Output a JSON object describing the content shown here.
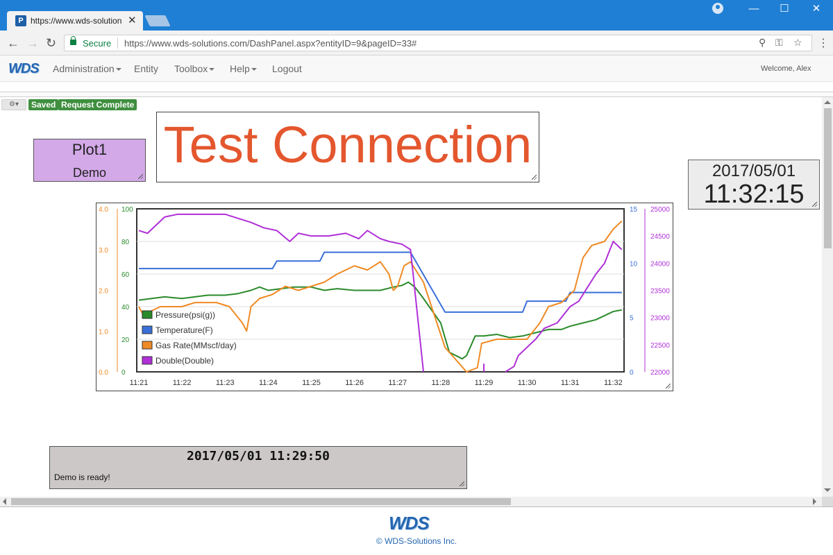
{
  "browser": {
    "tab_title": "https://www.wds-solution",
    "tab_favicon": "P",
    "secure_label": "Secure",
    "url": "https://www.wds-solutions.com/DashPanel.aspx?entityID=9&pageID=33#"
  },
  "navbar": {
    "brand": "WDS",
    "items": [
      {
        "label": "Administration",
        "dropdown": true
      },
      {
        "label": "Entity",
        "dropdown": false
      },
      {
        "label": "Toolbox",
        "dropdown": true
      },
      {
        "label": "Help",
        "dropdown": true
      },
      {
        "label": "Logout",
        "dropdown": false
      }
    ],
    "welcome": "Welcome, Alex"
  },
  "toolbar": {
    "gear_icon": "gear-icon",
    "badges": [
      "Saved",
      "Request Complete"
    ],
    "badge_color": "#3f8f3f"
  },
  "widgets": {
    "plot1": {
      "title": "Plot1",
      "subtitle": "Demo",
      "bg": "#d3a9e8"
    },
    "test_connection": {
      "text": "Test Connection",
      "color": "#e4572e"
    },
    "clock": {
      "date": "2017/05/01",
      "time": "11:32:15"
    },
    "status": {
      "timestamp": "2017/05/01 11:29:50",
      "message": "Demo is ready!"
    }
  },
  "footer": {
    "logo": "WDS",
    "copyright": "© WDS-Solutions Inc."
  },
  "chart_data": {
    "type": "line",
    "x_ticks": [
      "11:21",
      "11:22",
      "11:23",
      "11:24",
      "11:25",
      "11:26",
      "11:27",
      "11:28",
      "11:29",
      "11:30",
      "11:31",
      "11:32"
    ],
    "axes": [
      {
        "id": "gas",
        "side": "left-outer",
        "color": "#f08a24",
        "ticks": [
          "0.0",
          "1.0",
          "2.0",
          "3.0",
          "4.0"
        ],
        "range": [
          0,
          4
        ]
      },
      {
        "id": "pressure",
        "side": "left-inner",
        "color": "#2a8a2a",
        "ticks": [
          "0",
          "20",
          "40",
          "60",
          "80",
          "100"
        ],
        "range": [
          0,
          100
        ]
      },
      {
        "id": "temp",
        "side": "right-inner",
        "color": "#3a6fd8",
        "ticks": [
          "0",
          "5",
          "10",
          "15"
        ],
        "range": [
          0,
          15
        ]
      },
      {
        "id": "double",
        "side": "right-outer",
        "color": "#b02fd8",
        "ticks": [
          "22000",
          "22500",
          "23000",
          "23500",
          "24000",
          "24500",
          "25000"
        ],
        "range": [
          22000,
          25000
        ]
      }
    ],
    "legend_position": "bottom-left",
    "grid": true,
    "series": [
      {
        "name": "Pressure(psi(g))",
        "axis": "pressure",
        "color": "#2a8a2a",
        "x": [
          0,
          0.3,
          0.6,
          1.0,
          1.3,
          1.6,
          2.0,
          2.3,
          2.6,
          2.8,
          3.0,
          3.3,
          3.6,
          4.0,
          4.3,
          4.6,
          5.0,
          5.3,
          5.6,
          5.9,
          6.1,
          6.25,
          6.4,
          6.6,
          7.0,
          7.2,
          7.5,
          7.6,
          7.8,
          8.0,
          8.3,
          8.6,
          8.9,
          9.2,
          9.5,
          9.8,
          10.0,
          10.3,
          10.6,
          11.0,
          11.2
        ],
        "y": [
          44,
          45,
          46,
          45,
          46,
          47,
          47,
          48,
          50,
          52,
          50,
          51,
          52,
          52,
          50,
          51,
          50,
          50,
          50,
          52,
          53,
          55,
          52,
          45,
          30,
          12,
          8,
          10,
          22,
          22,
          23,
          21,
          22,
          24,
          26,
          26,
          28,
          30,
          32,
          37,
          38
        ]
      },
      {
        "name": "Temperature(F)",
        "axis": "temp",
        "color": "#3a6fd8",
        "x": [
          0,
          3.1,
          3.2,
          4.2,
          4.3,
          6.3,
          7.1,
          8.9,
          9.0,
          9.9,
          10.0,
          11.2
        ],
        "y": [
          9.5,
          9.5,
          10.2,
          10.2,
          11,
          11,
          5.5,
          5.5,
          6.5,
          6.5,
          7.3,
          7.3
        ]
      },
      {
        "name": "Gas Rate(MMscf/day)",
        "axis": "gas",
        "color": "#f08a24",
        "x": [
          0,
          0.1,
          0.5,
          1.0,
          1.3,
          1.8,
          2.1,
          2.4,
          2.5,
          2.6,
          2.8,
          3.1,
          3.4,
          3.7,
          4.0,
          4.3,
          4.6,
          5.0,
          5.3,
          5.6,
          5.8,
          5.9,
          6.0,
          6.15,
          6.3,
          6.6,
          7.1,
          7.6,
          7.85,
          7.95,
          8.3,
          8.7,
          9.0,
          9.3,
          9.5,
          9.8,
          10.1,
          10.3,
          10.5,
          10.8,
          11.0,
          11.2
        ],
        "y": [
          1.6,
          1.4,
          1.6,
          1.6,
          1.7,
          1.7,
          1.6,
          1.2,
          1.0,
          1.6,
          1.8,
          1.9,
          2.1,
          2.0,
          2.1,
          2.2,
          2.4,
          2.6,
          2.5,
          2.7,
          2.4,
          2.0,
          2.1,
          2.6,
          2.7,
          2.2,
          0.6,
          0.0,
          0.1,
          0.7,
          0.8,
          0.8,
          0.8,
          1.2,
          1.6,
          1.7,
          2.0,
          2.8,
          3.1,
          3.2,
          3.5,
          3.7
        ]
      },
      {
        "name": "Double(Double)",
        "axis": "double",
        "color": "#b02fd8",
        "segments": [
          {
            "x": [
              0,
              0.2,
              0.4,
              0.6,
              0.9,
              1.3,
              1.7,
              2.0,
              2.4,
              2.6,
              2.9,
              3.2,
              3.5,
              3.7,
              4.0,
              4.4,
              4.8,
              5.1,
              5.3,
              5.6,
              5.8,
              6.1,
              6.3,
              6.6
            ],
            "y": [
              24600,
              24550,
              24700,
              24850,
              24900,
              24900,
              24900,
              24900,
              24800,
              24750,
              24650,
              24600,
              24400,
              24550,
              24500,
              24500,
              24550,
              24450,
              24600,
              24450,
              24400,
              24350,
              24250,
              22000
            ]
          },
          {
            "x": [
              8.0,
              8.0
            ],
            "y": [
              22150,
              22000
            ]
          },
          {
            "x": [
              8.5,
              8.7,
              8.8,
              9.0,
              9.2,
              9.4,
              9.7,
              10.0,
              10.2,
              10.4,
              10.6,
              10.8,
              11.0,
              11.2
            ],
            "y": [
              22000,
              22100,
              22300,
              22450,
              22600,
              22800,
              22900,
              23200,
              23300,
              23550,
              23800,
              24000,
              24400,
              24250
            ]
          }
        ]
      }
    ]
  }
}
